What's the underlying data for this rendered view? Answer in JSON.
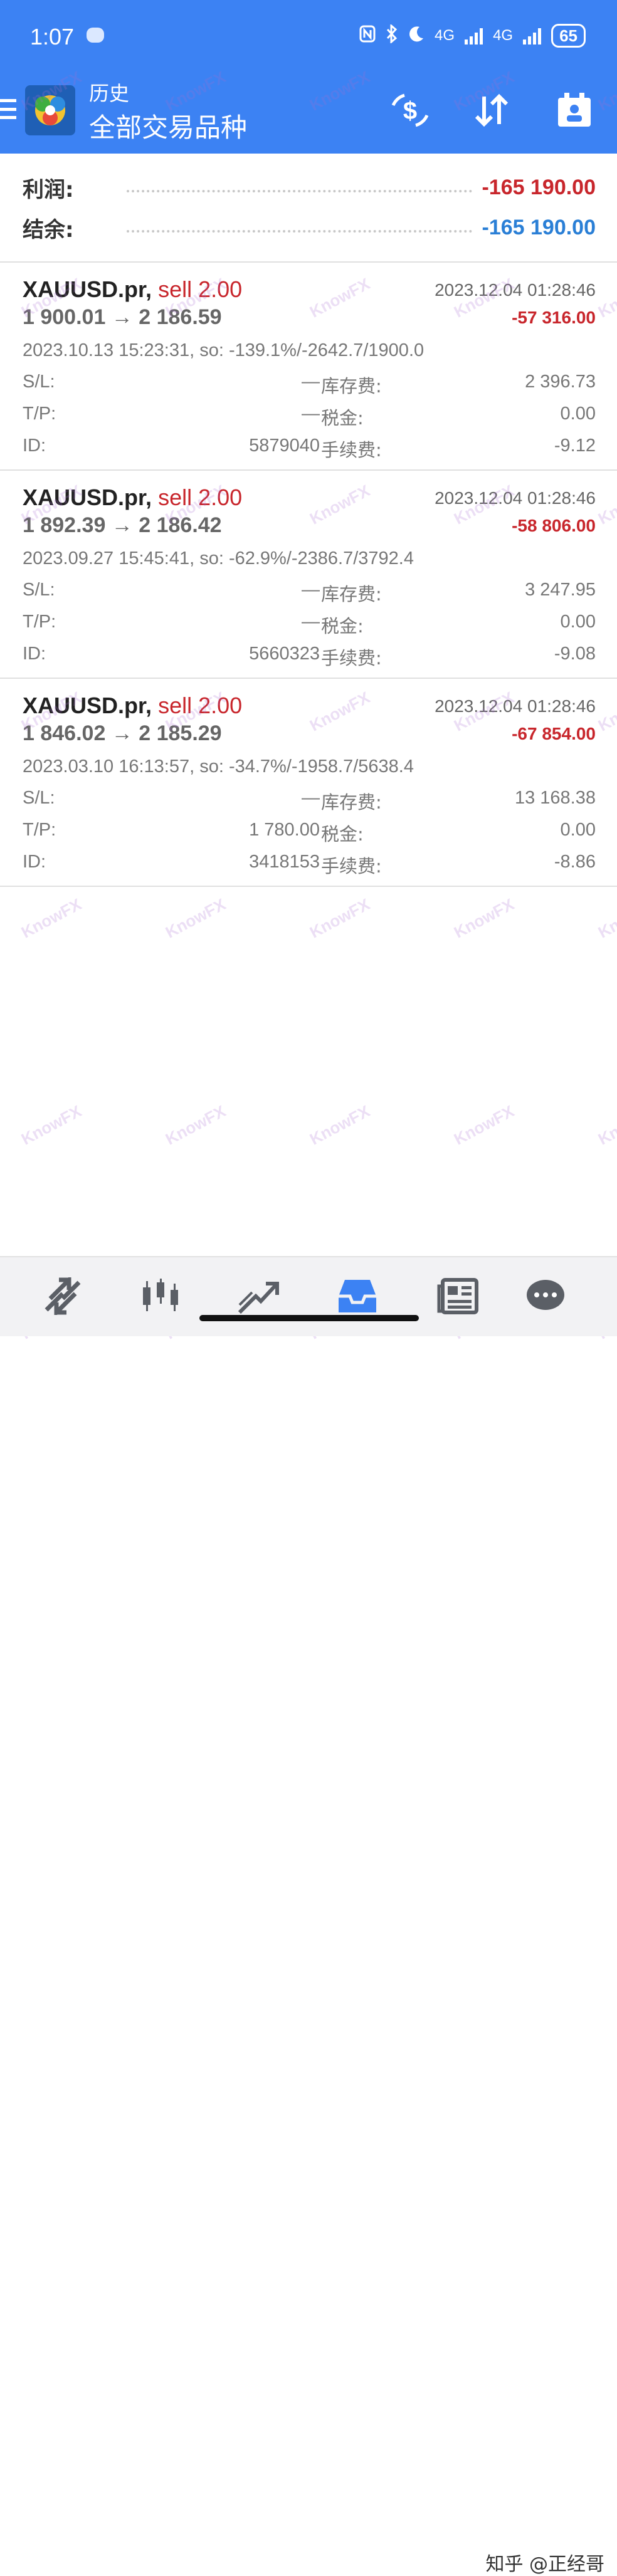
{
  "status_bar": {
    "time": "1:07",
    "network1": "4G",
    "network2": "4G",
    "battery": "65"
  },
  "app_bar": {
    "title": "历史",
    "subtitle": "全部交易品种"
  },
  "summary": {
    "profit_label": "利润:",
    "profit_value": "-165 190.00",
    "balance_label": "结余:",
    "balance_value": "-165 190.00"
  },
  "trades": [
    {
      "symbol": "XAUUSD.pr,",
      "side": "sell 2.00",
      "close_time": "2023.12.04 01:28:46",
      "prices": "1 900.01 → 2 186.59",
      "profit": "-57 316.00",
      "open_info": "2023.10.13 15:23:31, so: -139.1%/-2642.7/1900.0",
      "sl_label": "S/L:",
      "sl_value": "—",
      "swap_label": "库存费:",
      "swap_value": "2 396.73",
      "tp_label": "T/P:",
      "tp_value": "—",
      "tax_label": "税金:",
      "tax_value": "0.00",
      "id_label": "ID:",
      "id_value": "5879040",
      "fee_label": "手续费:",
      "fee_value": "-9.12"
    },
    {
      "symbol": "XAUUSD.pr,",
      "side": "sell 2.00",
      "close_time": "2023.12.04 01:28:46",
      "prices": "1 892.39 → 2 186.42",
      "profit": "-58 806.00",
      "open_info": "2023.09.27 15:45:41, so: -62.9%/-2386.7/3792.4",
      "sl_label": "S/L:",
      "sl_value": "—",
      "swap_label": "库存费:",
      "swap_value": "3 247.95",
      "tp_label": "T/P:",
      "tp_value": "—",
      "tax_label": "税金:",
      "tax_value": "0.00",
      "id_label": "ID:",
      "id_value": "5660323",
      "fee_label": "手续费:",
      "fee_value": "-9.08"
    },
    {
      "symbol": "XAUUSD.pr,",
      "side": "sell 2.00",
      "close_time": "2023.12.04 01:28:46",
      "prices": "1 846.02 → 2 185.29",
      "profit": "-67 854.00",
      "open_info": "2023.03.10 16:13:57, so: -34.7%/-1958.7/5638.4",
      "sl_label": "S/L:",
      "sl_value": "—",
      "swap_label": "库存费:",
      "swap_value": "13 168.38",
      "tp_label": "T/P:",
      "tp_value": "1 780.00",
      "tax_label": "税金:",
      "tax_value": "0.00",
      "id_label": "ID:",
      "id_value": "3418153",
      "fee_label": "手续费:",
      "fee_value": "-8.86"
    }
  ],
  "bottom_nav": {
    "items": [
      "quotes-icon",
      "chart-icon",
      "trade-icon",
      "history-icon",
      "news-icon",
      "messages-icon"
    ],
    "active": "history-icon",
    "active_color": "#3c82f3"
  },
  "watermark": "KnowFX",
  "credit": "知乎 @正经哥",
  "colors": {
    "header_bg": "#3c82f3",
    "loss_red": "#c8262c",
    "balance_blue": "#2a7fd6"
  }
}
